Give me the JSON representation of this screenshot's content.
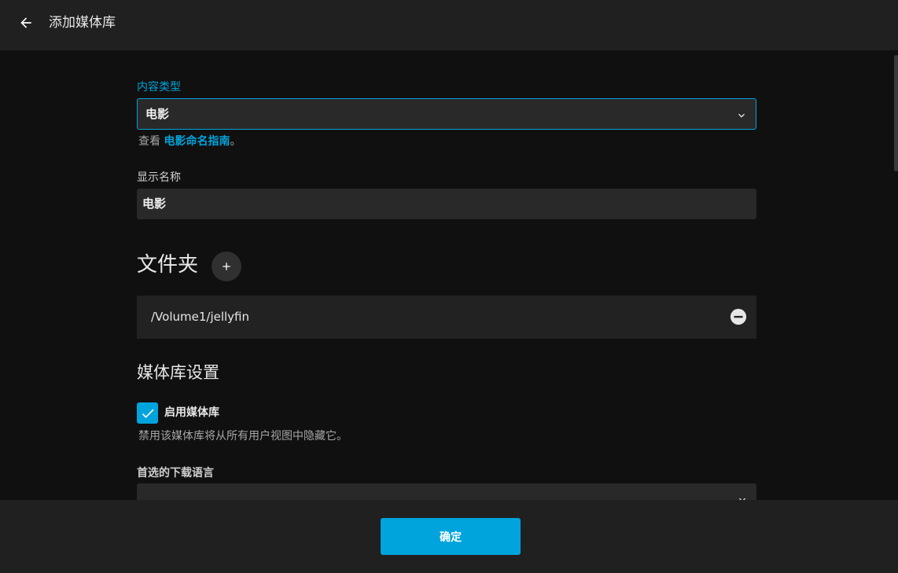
{
  "header": {
    "title": "添加媒体库",
    "back_icon": "arrow-left-icon"
  },
  "content_type": {
    "label": "内容类型",
    "value": "电影",
    "hint_prefix": "查看 ",
    "hint_link": "电影命名指南",
    "hint_suffix": "。"
  },
  "display_name": {
    "label": "显示名称",
    "value": "电影"
  },
  "folders": {
    "title": "文件夹",
    "items": [
      {
        "path": "/Volume1/jellyfin"
      }
    ]
  },
  "library_settings": {
    "title": "媒体库设置",
    "enable_label": "启用媒体库",
    "enable_checked": true,
    "enable_hint": "禁用该媒体库将从所有用户视图中隐藏它。",
    "preferred_language_label": "首选的下载语言",
    "preferred_language_value": ""
  },
  "footer": {
    "confirm_label": "确定"
  },
  "colors": {
    "accent": "#00a4dc",
    "header_bg": "#202020",
    "page_bg": "#101010",
    "input_bg": "#292929"
  }
}
